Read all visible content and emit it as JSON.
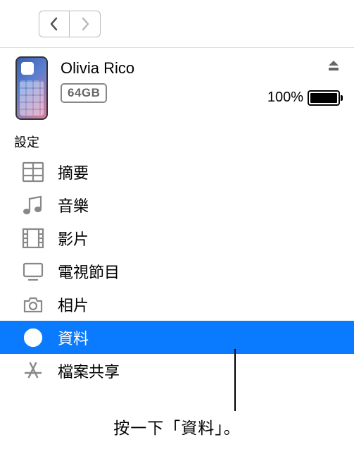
{
  "device": {
    "name": "Olivia Rico",
    "storage": "64GB",
    "battery_pct": "100%"
  },
  "section_label": "設定",
  "sidebar": {
    "items": [
      {
        "id": "summary",
        "label": "摘要",
        "selected": false
      },
      {
        "id": "music",
        "label": "音樂",
        "selected": false
      },
      {
        "id": "movies",
        "label": "影片",
        "selected": false
      },
      {
        "id": "tv",
        "label": "電視節目",
        "selected": false
      },
      {
        "id": "photos",
        "label": "相片",
        "selected": false
      },
      {
        "id": "info",
        "label": "資料",
        "selected": true
      },
      {
        "id": "filesharing",
        "label": "檔案共享",
        "selected": false
      }
    ]
  },
  "annotation": "按一下「資料」。"
}
